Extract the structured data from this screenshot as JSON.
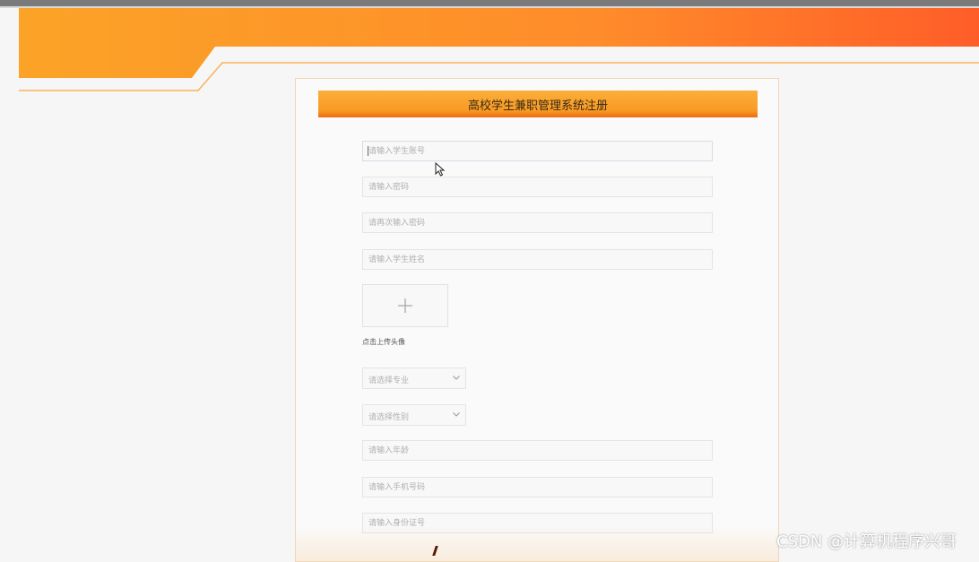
{
  "page": {
    "title": "高校学生兼职管理系统注册"
  },
  "form": {
    "fields": [
      {
        "name": "student-account",
        "placeholder": "请输入学生账号"
      },
      {
        "name": "password",
        "placeholder": "请输入密码"
      },
      {
        "name": "confirm-password",
        "placeholder": "请再次输入密码"
      },
      {
        "name": "student-name",
        "placeholder": "请输入学生姓名"
      },
      {
        "name": "age",
        "placeholder": "请输入年龄"
      },
      {
        "name": "phone",
        "placeholder": "请输入手机号码"
      },
      {
        "name": "id-card",
        "placeholder": "请输入身份证号"
      }
    ],
    "upload": {
      "icon": "plus-icon",
      "label": "点击上传头像"
    },
    "selects": {
      "major": {
        "placeholder": "请选择专业",
        "icon": "chevron-down-icon"
      },
      "gender": {
        "placeholder": "请选择性别",
        "icon": "chevron-down-icon"
      }
    }
  },
  "watermark": "CSDN @计算机程序兴哥",
  "colors": {
    "accent_orange": "#f79a24",
    "accent_red_orange": "#ff5a28",
    "title_text": "#3a2a12"
  }
}
